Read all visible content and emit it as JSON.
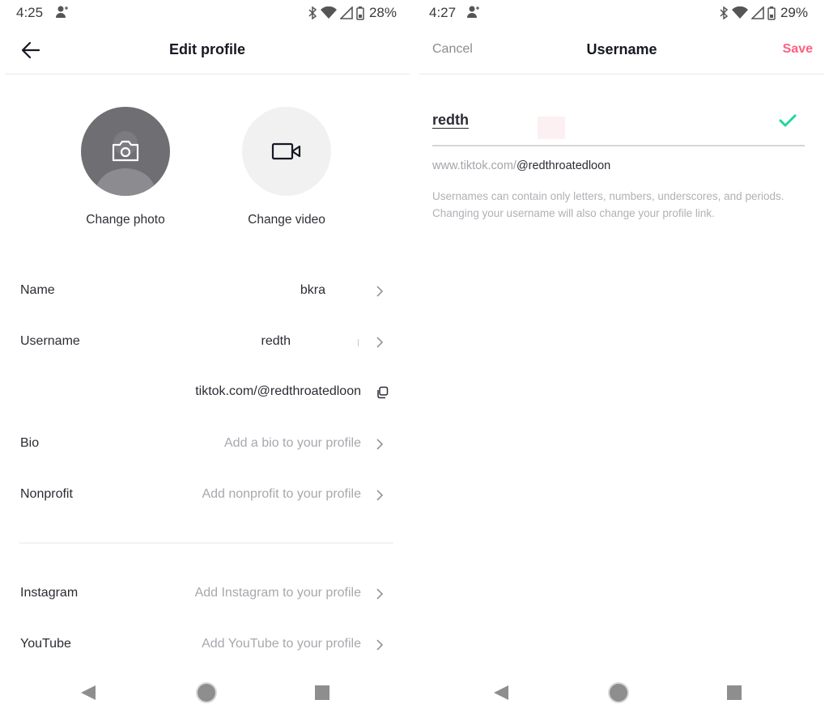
{
  "left": {
    "status": {
      "time": "4:25",
      "battery": "28%"
    },
    "header": {
      "title": "Edit profile"
    },
    "media": {
      "photo_label": "Change photo",
      "video_label": "Change video"
    },
    "fields": {
      "name": {
        "label": "Name",
        "value": "bkrа"
      },
      "username": {
        "label": "Username",
        "value": "redth"
      },
      "link": {
        "value": "tiktok.com/@redthroatedloon"
      },
      "bio": {
        "label": "Bio",
        "placeholder": "Add a bio to your profile"
      },
      "nonprofit": {
        "label": "Nonprofit",
        "placeholder": "Add nonprofit to your profile"
      },
      "instagram": {
        "label": "Instagram",
        "placeholder": "Add Instagram to your profile"
      },
      "youtube": {
        "label": "YouTube",
        "placeholder": "Add YouTube to your profile"
      }
    }
  },
  "right": {
    "status": {
      "time": "4:27",
      "battery": "29%"
    },
    "header": {
      "cancel": "Cancel",
      "title": "Username",
      "save": "Save"
    },
    "input": {
      "value": "redth"
    },
    "url_prefix": "www.tiktok.com/",
    "url_handle": "@redthroatedloon",
    "hint": "Usernames can contain only letters, numbers, underscores, and periods. Changing your username will also change your profile link."
  },
  "colors": {
    "accent": "#fe2c55",
    "valid": "#20d5a0",
    "text_primary": "#161823",
    "text_secondary": "#a7a8ad"
  },
  "icons": {
    "back": "arrow-left",
    "camera": "camera",
    "video": "video-camera",
    "chevron": "chevron-right",
    "copy": "copy",
    "check": "checkmark"
  }
}
